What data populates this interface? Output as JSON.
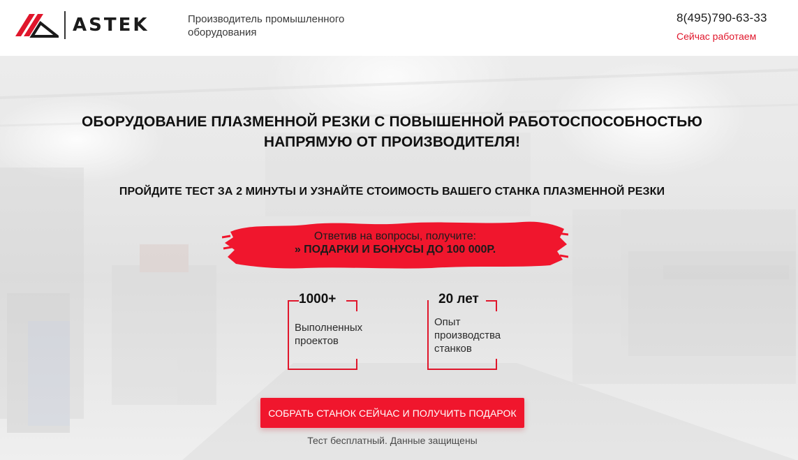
{
  "header": {
    "logo_text": "ASTEK",
    "tagline": "Производитель промышленного оборудования",
    "phone": "8(495)790-63-33",
    "status": "Сейчас работаем"
  },
  "hero": {
    "title": "ОБОРУДОВАНИЕ ПЛАЗМЕННОЙ РЕЗКИ С ПОВЫШЕННОЙ РАБОТОСПОСОБНОСТЬЮ НАПРЯМУЮ ОТ ПРОИЗВОДИТЕЛЯ!",
    "subtitle": "ПРОЙДИТЕ ТЕСТ ЗА 2 МИНУТЫ И УЗНАЙТЕ СТОИМОСТЬ ВАШЕГО СТАНКА ПЛАЗМЕННОЙ РЕЗКИ",
    "promo_line1": "Ответив на вопросы, получите:",
    "promo_line2": "» ПОДАРКИ И БОНУСЫ ДО 100 000Р.",
    "stats": [
      {
        "value": "1000+",
        "label": "Выполненных проектов"
      },
      {
        "value": "20 лет",
        "label": "Опыт производства станков"
      }
    ],
    "cta_label": "СОБРАТЬ СТАНОК СЕЙЧАС И ПОЛУЧИТЬ ПОДАРОК",
    "cta_note": "Тест бесплатный. Данные защищены"
  },
  "colors": {
    "accent": "#f0162d",
    "status": "#e0162b",
    "text": "#111111"
  },
  "icons": {
    "logo": "astek-logo-icon"
  }
}
